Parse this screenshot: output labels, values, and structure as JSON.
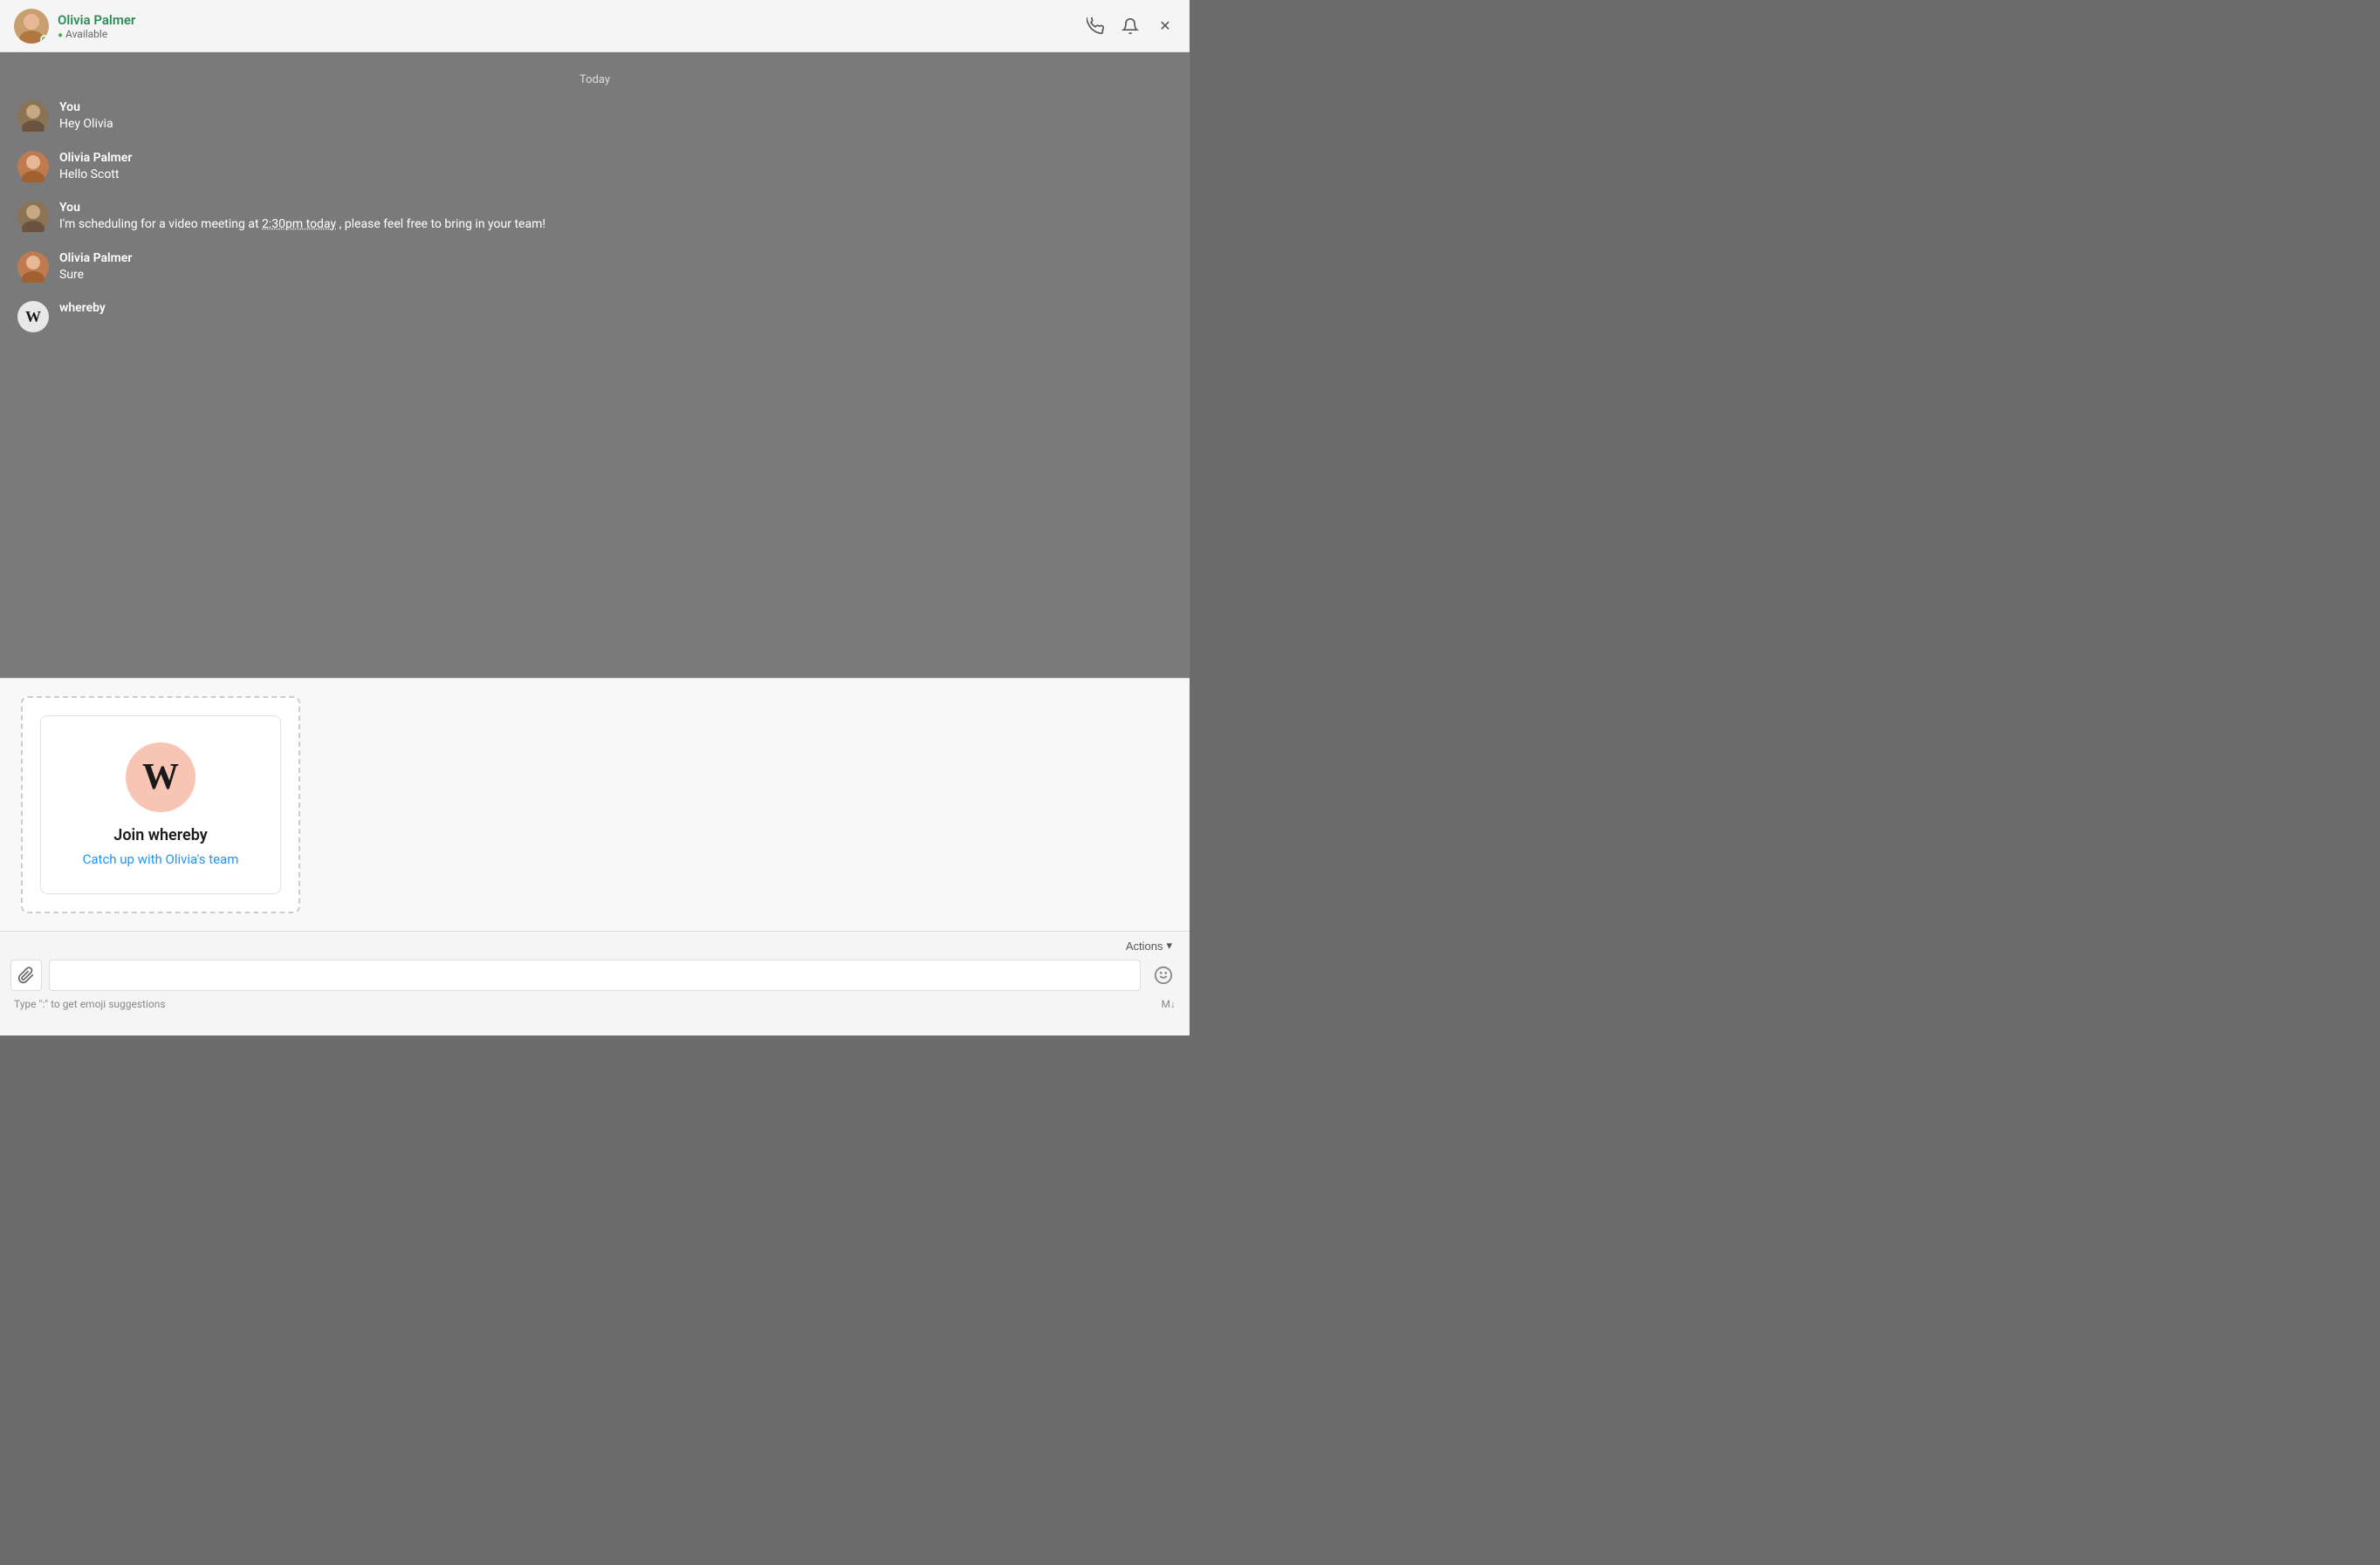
{
  "header": {
    "contact_name": "Olivia Palmer",
    "status": "Available",
    "status_color": "#4caf50",
    "call_icon": "📞",
    "bell_icon": "🔔",
    "close_icon": "✕"
  },
  "chat": {
    "date_divider": "Today",
    "messages": [
      {
        "id": "msg1",
        "sender": "You",
        "sender_type": "you",
        "text": "Hey Olivia"
      },
      {
        "id": "msg2",
        "sender": "Olivia Palmer",
        "sender_type": "olivia",
        "text": "Hello Scott"
      },
      {
        "id": "msg3",
        "sender": "You",
        "sender_type": "you",
        "text_parts": [
          {
            "type": "normal",
            "text": "I'm scheduling for a video meeting at "
          },
          {
            "type": "highlight",
            "text": "2:30pm today"
          },
          {
            "type": "normal",
            "text": " , please feel free to bring in your team!"
          }
        ]
      },
      {
        "id": "msg4",
        "sender": "Olivia Palmer",
        "sender_type": "olivia",
        "text": "Sure"
      },
      {
        "id": "msg5",
        "sender": "whereby",
        "sender_type": "whereby",
        "text": ""
      }
    ]
  },
  "whereby_card": {
    "logo_letter": "W",
    "title": "Join whereby",
    "link_text": "Catch up with Olivia's team"
  },
  "toolbar": {
    "actions_label": "Actions",
    "chevron": "▾",
    "hint_text": "Type \":\" to get emoji suggestions",
    "markdown_hint": "M↓"
  },
  "input": {
    "placeholder": ""
  }
}
